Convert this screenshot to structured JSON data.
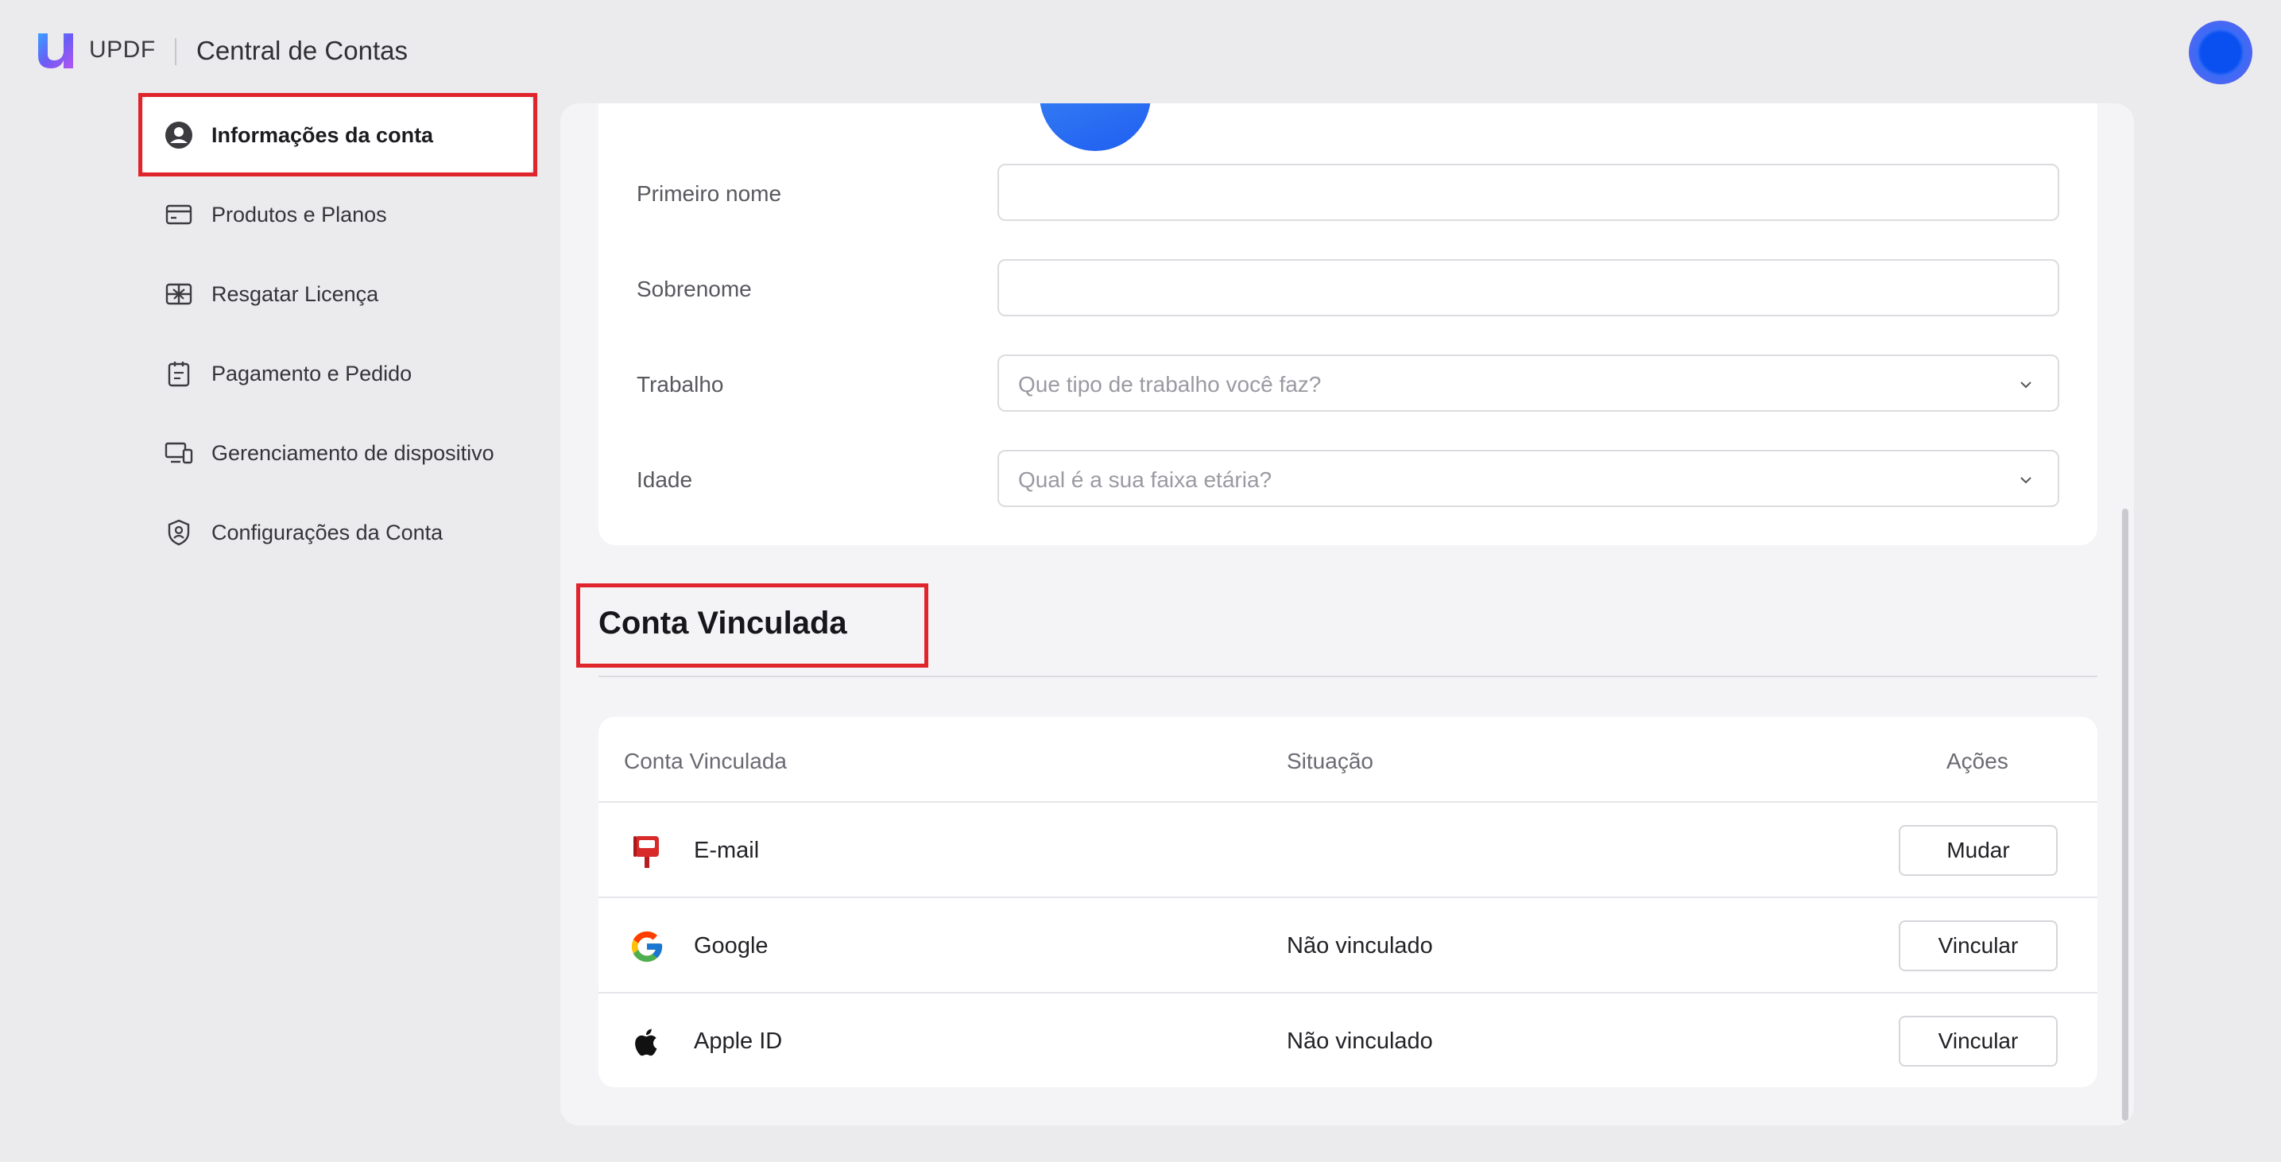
{
  "header": {
    "brand": "UPDF",
    "title": "Central de Contas"
  },
  "sidebar": {
    "items": [
      {
        "label": "Informações da conta",
        "icon": "user-circle-icon",
        "active": true
      },
      {
        "label": "Produtos e Planos",
        "icon": "card-icon"
      },
      {
        "label": "Resgatar Licença",
        "icon": "gift-icon"
      },
      {
        "label": "Pagamento e Pedido",
        "icon": "clipboard-icon"
      },
      {
        "label": "Gerenciamento de dispositivo",
        "icon": "devices-icon"
      },
      {
        "label": "Configurações da Conta",
        "icon": "shield-user-icon"
      }
    ]
  },
  "form": {
    "first_name_label": "Primeiro nome",
    "first_name_value": "",
    "last_name_label": "Sobrenome",
    "last_name_value": "",
    "job_label": "Trabalho",
    "job_placeholder": "Que tipo de trabalho você faz?",
    "age_label": "Idade",
    "age_placeholder": "Qual é a sua faixa etária?"
  },
  "linked": {
    "section_title": "Conta Vinculada",
    "columns": [
      "Conta Vinculada",
      "Situação",
      "Ações"
    ],
    "rows": [
      {
        "name": "E-mail",
        "status": "",
        "action": "Mudar",
        "icon": "mailbox-icon"
      },
      {
        "name": "Google",
        "status": "Não vinculado",
        "action": "Vincular",
        "icon": "google-icon"
      },
      {
        "name": "Apple ID",
        "status": "Não vinculado",
        "action": "Vincular",
        "icon": "apple-icon"
      }
    ]
  },
  "colors": {
    "highlight": "#e0242b",
    "brand_blue": "#1f5ef0"
  }
}
